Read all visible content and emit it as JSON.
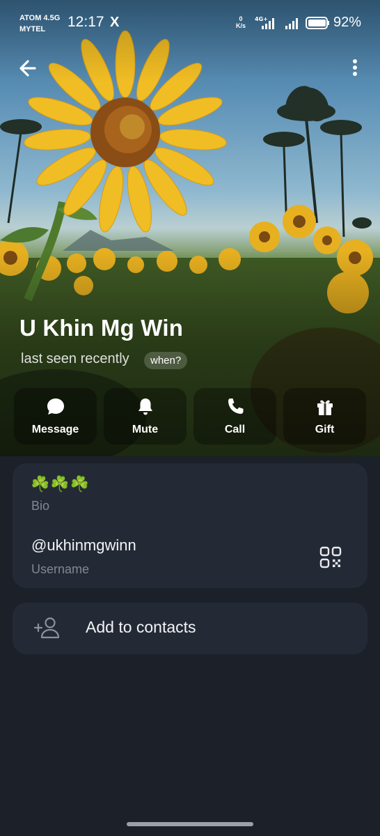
{
  "status_bar": {
    "carrier_line1": "ATOM 4.5G",
    "carrier_line2": "MYTEL",
    "time": "12:17",
    "notification_icon": "X",
    "net_speed_value": "0",
    "net_speed_unit": "K/s",
    "network_type": "4G+",
    "battery_percent": "92%"
  },
  "header": {
    "back_icon": "arrow-left-icon",
    "more_icon": "vertical-dots-icon"
  },
  "profile": {
    "name": "U Khin Mg Win",
    "last_seen": "last seen recently",
    "when_label": "when?"
  },
  "actions": [
    {
      "label": "Message",
      "icon": "chat-bubble-icon"
    },
    {
      "label": "Mute",
      "icon": "bell-icon"
    },
    {
      "label": "Call",
      "icon": "phone-icon"
    },
    {
      "label": "Gift",
      "icon": "gift-icon"
    }
  ],
  "info": {
    "bio": "☘️☘️☘️",
    "bio_label": "Bio",
    "username": "@ukhinmgwinn",
    "username_label": "Username",
    "qr_icon": "qr-code-icon"
  },
  "contacts": {
    "label": "Add to contacts",
    "icon": "add-person-icon"
  },
  "colors": {
    "background": "#1b2029",
    "card": "#242a35",
    "secondary_text": "#7f8894"
  }
}
